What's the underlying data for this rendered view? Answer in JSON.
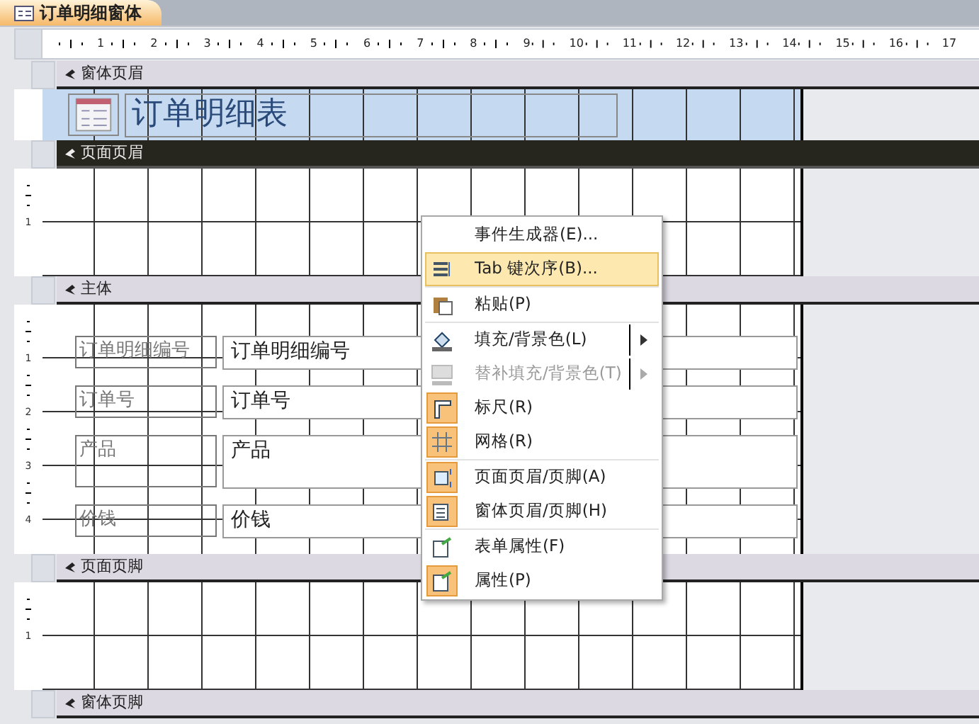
{
  "document_tab": {
    "title": "订单明细窗体",
    "selected": true
  },
  "ruler": {
    "numbers": [
      "1",
      "2",
      "3",
      "4",
      "5",
      "6",
      "7",
      "8",
      "9",
      "10",
      "11",
      "12",
      "13",
      "14",
      "15",
      "16",
      "17"
    ]
  },
  "sections": [
    {
      "kind": "form_header",
      "title": "窗体页眉",
      "selected": false,
      "heading": "订单明细表"
    },
    {
      "kind": "grid",
      "title": "页面页眉",
      "selected": true,
      "ruler_numbers": [
        "1"
      ]
    },
    {
      "kind": "fields",
      "title": "主体",
      "selected": false,
      "ruler_numbers": [
        "1",
        "2",
        "3",
        "4"
      ],
      "fields": [
        {
          "label": "订单明细编号",
          "value": "订单明细编号",
          "tall": false
        },
        {
          "label": "订单号",
          "value": "订单号",
          "tall": false
        },
        {
          "label": "产品",
          "value": "产品",
          "tall": true
        },
        {
          "label": "价钱",
          "value": "价钱",
          "tall": false
        }
      ]
    },
    {
      "kind": "grid",
      "title": "页面页脚",
      "selected": false,
      "ruler_numbers": [
        "1"
      ]
    },
    {
      "kind": "footer",
      "title": "窗体页脚",
      "selected": false
    }
  ],
  "context_menu": {
    "groups": [
      [
        {
          "label": "事件生成器(E)...",
          "checked": false,
          "disabled": false,
          "selected": false,
          "submenu": false
        },
        {
          "label": "Tab 键次序(B)...",
          "checked": false,
          "disabled": false,
          "selected": true,
          "submenu": false
        }
      ],
      [
        {
          "label": "粘贴(P)",
          "checked": false,
          "disabled": false,
          "selected": false,
          "submenu": false
        }
      ],
      [
        {
          "label": "填充/背景色(L)",
          "checked": false,
          "disabled": false,
          "selected": false,
          "submenu": true
        },
        {
          "label": "替补填充/背景色(T)",
          "checked": false,
          "disabled": true,
          "selected": false,
          "submenu": true
        },
        {
          "label": "标尺(R)",
          "checked": true,
          "disabled": false,
          "selected": false,
          "submenu": false
        },
        {
          "label": "网格(R)",
          "checked": true,
          "disabled": false,
          "selected": false,
          "submenu": false
        }
      ],
      [
        {
          "label": "页面页眉/页脚(A)",
          "checked": true,
          "disabled": false,
          "selected": false,
          "submenu": false
        },
        {
          "label": "窗体页眉/页脚(H)",
          "checked": true,
          "disabled": false,
          "selected": false,
          "submenu": false
        }
      ],
      [
        {
          "label": "表单属性(F)",
          "checked": false,
          "disabled": false,
          "selected": false,
          "submenu": false
        },
        {
          "label": "属性(P)",
          "checked": true,
          "disabled": false,
          "selected": false,
          "submenu": false
        }
      ]
    ]
  }
}
